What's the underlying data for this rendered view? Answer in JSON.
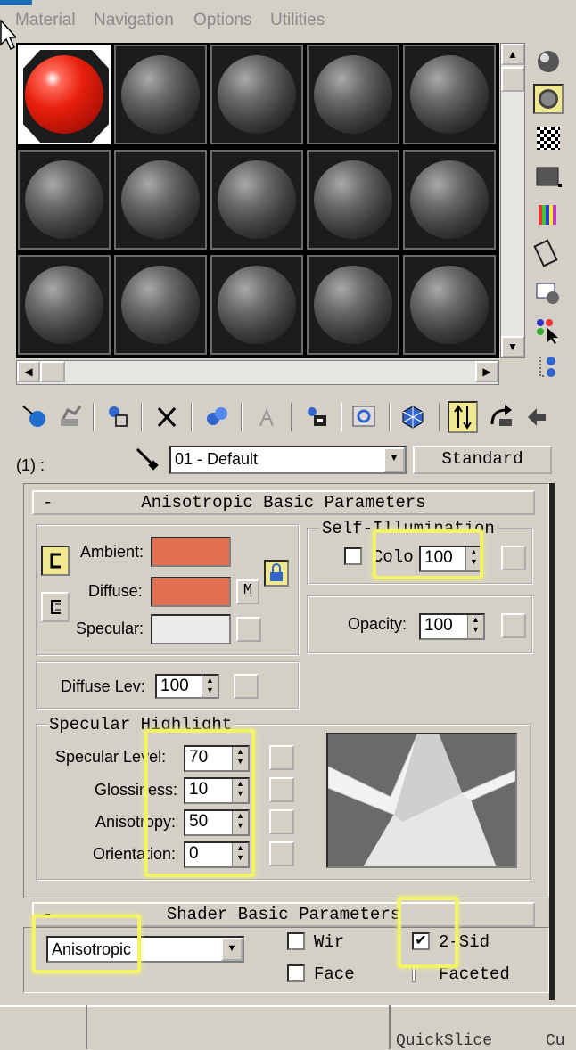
{
  "menu": [
    "Material",
    "Navigation",
    "Options",
    "Utilities"
  ],
  "material": {
    "slot_label": "(1) :",
    "name": "01 - Default",
    "type_button": "Standard"
  },
  "aniso_rollout": {
    "title": "Anisotropic Basic Parameters",
    "collapse": "-",
    "ambient_label": "Ambient:",
    "diffuse_label": "Diffuse:",
    "specular_label": "Specular:",
    "ambient_color": "#e07050",
    "diffuse_color": "#e07050",
    "specular_color": "#ecebe9",
    "map_m": "M",
    "self_illum_title": "Self-Illumination",
    "color_label": "Colo",
    "color_value": "100",
    "opacity_label": "Opacity:",
    "opacity_value": "100",
    "diffuse_level_label": "Diffuse Lev:",
    "diffuse_level_value": "100",
    "spec_highlight_title": "Specular Highlight",
    "specular_level_label": "Specular Level:",
    "specular_level_value": "70",
    "glossiness_label": "Glossiness:",
    "glossiness_value": "10",
    "anisotropy_label": "Anisotropy:",
    "anisotropy_value": "50",
    "orientation_label": "Orientation:",
    "orientation_value": "0"
  },
  "shader_rollout": {
    "title": "Shader Basic Parameters",
    "collapse": "-",
    "shader_type": "Anisotropic",
    "wire_label": "Wir",
    "two_sided_label": "2-Sid",
    "face_map_label": "Face",
    "faceted_label": "Faceted",
    "wire_checked": false,
    "two_sided_checked": true,
    "face_map_checked": false
  },
  "bottom": {
    "tab_label": "QuickSlice",
    "tab_label2": "Cu"
  },
  "icons": {
    "side": [
      "sample-type-sphere-icon",
      "backlight-icon",
      "background-checker-icon",
      "sample-uv-tiling-icon",
      "video-color-check-icon",
      "make-preview-icon",
      "options-icon",
      "select-by-material-icon",
      "material-navigator-icon"
    ],
    "toolbar": [
      "get-material-icon",
      "put-to-scene-icon",
      "assign-to-selection-icon",
      "reset-map-icon",
      "make-unique-icon",
      "put-to-library-icon",
      "material-effects-channel-icon",
      "show-map-in-viewport-icon",
      "show-end-result-icon",
      "go-to-parent-icon",
      "go-forward-sibling-icon"
    ]
  }
}
